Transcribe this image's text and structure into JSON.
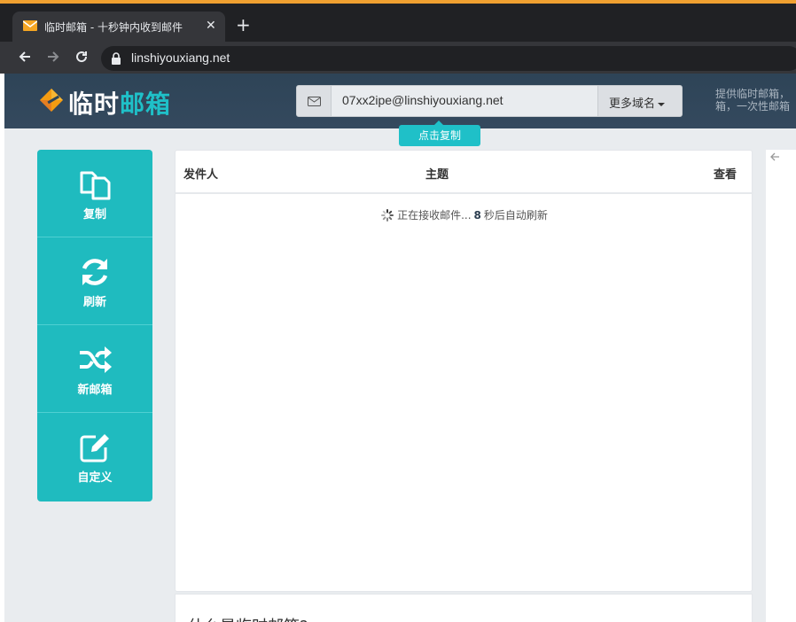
{
  "browser": {
    "tab_title": "临时邮箱 - 十秒钟内收到邮件",
    "tab_close": "✕",
    "new_tab": "+",
    "url": "linshiyouxiang.net"
  },
  "header": {
    "logo_main": "临时",
    "logo_accent": "邮箱",
    "email_value": "07xx2ipe@linshiyouxiang.net",
    "domain_button": "更多域名",
    "tagline_line1": "提供临时邮箱，",
    "tagline_line2": "箱，一次性邮箱",
    "copy_tooltip": "点击复制"
  },
  "actions": [
    {
      "label": "复制",
      "icon": "copy-icon"
    },
    {
      "label": "刷新",
      "icon": "refresh-icon"
    },
    {
      "label": "新邮箱",
      "icon": "shuffle-icon"
    },
    {
      "label": "自定义",
      "icon": "edit-icon"
    }
  ],
  "mail_table": {
    "col_sender": "发件人",
    "col_subject": "主题",
    "col_view": "查看",
    "status_prefix": "正在接收邮件...",
    "countdown": "8",
    "status_suffix": "秒后自动刷新"
  },
  "faq": {
    "title": "什么是临时邮箱?"
  },
  "colors": {
    "accent": "#1fbbbf",
    "header_bg": "#34495e",
    "logo_orange": "#f39c12"
  }
}
